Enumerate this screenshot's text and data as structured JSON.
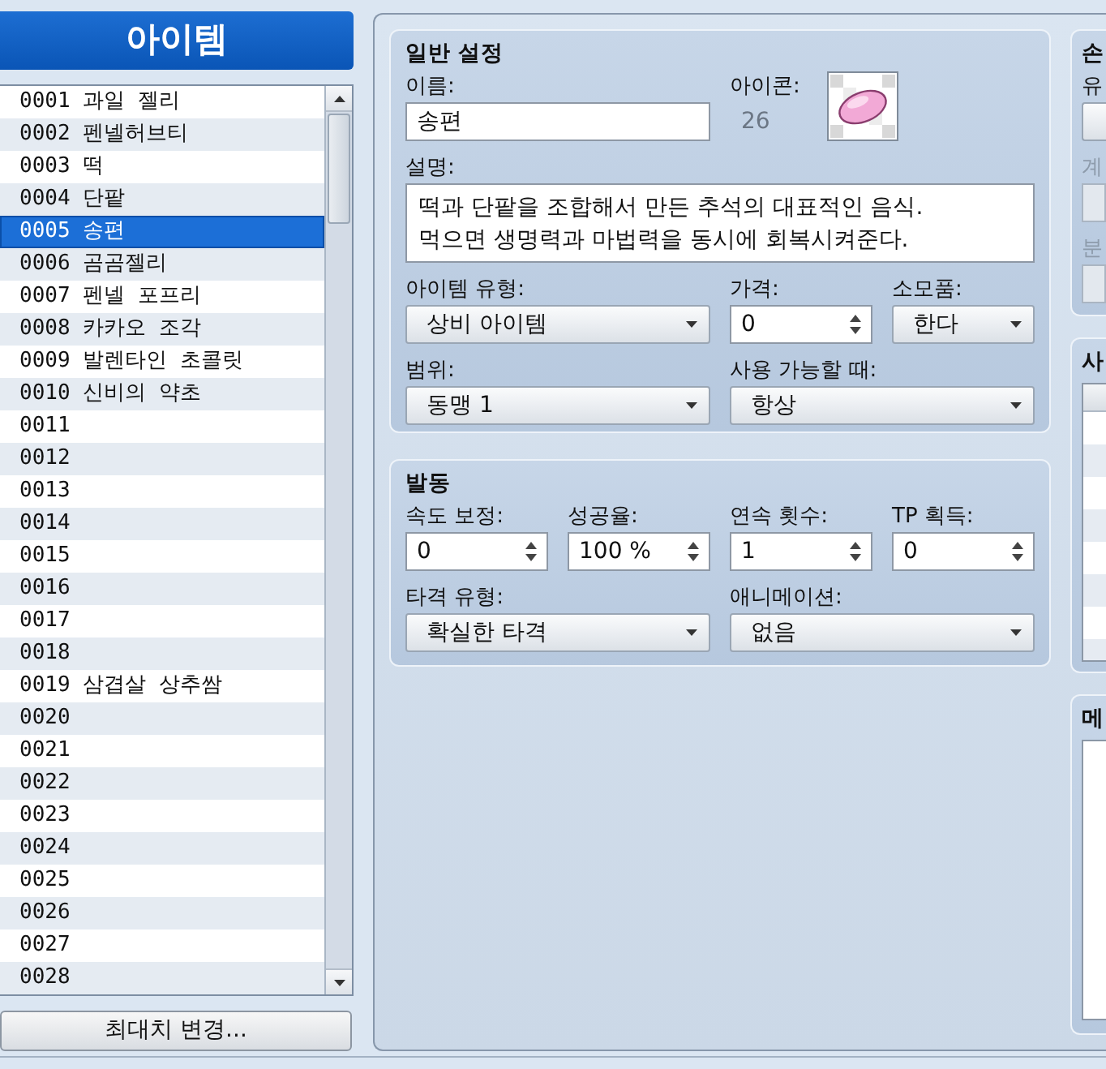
{
  "title": "아이템",
  "items": [
    {
      "number": "0001",
      "name": "과일 젤리",
      "selected": false
    },
    {
      "number": "0002",
      "name": "펜넬허브티",
      "selected": false
    },
    {
      "number": "0003",
      "name": "떡",
      "selected": false
    },
    {
      "number": "0004",
      "name": "단팥",
      "selected": false
    },
    {
      "number": "0005",
      "name": "송편",
      "selected": true
    },
    {
      "number": "0006",
      "name": "곰곰젤리",
      "selected": false
    },
    {
      "number": "0007",
      "name": "펜넬 포프리",
      "selected": false
    },
    {
      "number": "0008",
      "name": "카카오 조각",
      "selected": false
    },
    {
      "number": "0009",
      "name": "발렌타인 초콜릿",
      "selected": false
    },
    {
      "number": "0010",
      "name": "신비의 약초",
      "selected": false
    },
    {
      "number": "0011",
      "selected": false
    },
    {
      "number": "0012",
      "selected": false
    },
    {
      "number": "0013",
      "selected": false
    },
    {
      "number": "0014",
      "selected": false
    },
    {
      "number": "0015",
      "selected": false
    },
    {
      "number": "0016",
      "selected": false
    },
    {
      "number": "0017",
      "selected": false
    },
    {
      "number": "0018",
      "selected": false
    },
    {
      "number": "0019",
      "name": "삼겹살 상추쌈",
      "selected": false
    },
    {
      "number": "0020",
      "selected": false
    },
    {
      "number": "0021",
      "selected": false
    },
    {
      "number": "0022",
      "selected": false
    },
    {
      "number": "0023",
      "selected": false
    },
    {
      "number": "0024",
      "selected": false
    },
    {
      "number": "0025",
      "selected": false
    },
    {
      "number": "0026",
      "selected": false
    },
    {
      "number": "0027",
      "selected": false
    },
    {
      "number": "0028",
      "selected": false
    }
  ],
  "change_max_button": "최대치 변경...",
  "general": {
    "title": "일반 설정",
    "name": {
      "label": "이름:",
      "value": "송편"
    },
    "icon": {
      "label": "아이콘:",
      "index": "26"
    },
    "description": {
      "label": "설명:",
      "value": "떡과 단팥을 조합해서 만든 추석의 대표적인 음식.\n먹으면 생명력과 마법력을 동시에 회복시켜준다."
    },
    "item_type": {
      "label": "아이템 유형:",
      "value": "상비 아이템"
    },
    "price": {
      "label": "가격:",
      "value": "0"
    },
    "consumable": {
      "label": "소모품:",
      "value": "한다"
    },
    "scope": {
      "label": "범위:",
      "value": "동맹 1"
    },
    "occasion": {
      "label": "사용 가능할 때:",
      "value": "항상"
    }
  },
  "invocation": {
    "title": "발동",
    "fields": [
      {
        "kind": "spin",
        "label": "속도 보정:",
        "value": "0"
      },
      {
        "kind": "spin",
        "label": "성공율:",
        "value": "100 %"
      },
      {
        "kind": "spin",
        "label": "연속 횟수:",
        "value": "1"
      },
      {
        "kind": "spin",
        "label": "TP 획득:",
        "value": "0"
      },
      {
        "kind": "select",
        "label": "타격 유형:",
        "value": "확실한 타격"
      },
      {
        "kind": "select",
        "label": "애니메이션:",
        "value": "없음"
      }
    ]
  },
  "side_panels": [
    {
      "title": "손",
      "kind": "fields",
      "fields": [
        {
          "kind": "select",
          "label": "유",
          "disabled": false
        },
        {
          "kind": "input",
          "label": "계",
          "disabled": true
        },
        {
          "kind": "input",
          "label": "분",
          "disabled": true
        }
      ]
    },
    {
      "title": "사",
      "kind": "table"
    },
    {
      "title": "메",
      "kind": "memo"
    }
  ]
}
